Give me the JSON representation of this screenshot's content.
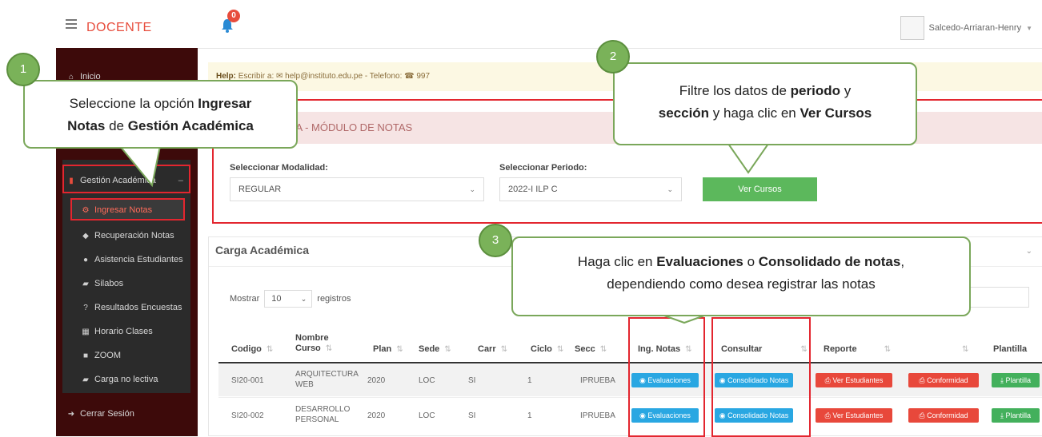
{
  "header": {
    "brand": "DOCENTE",
    "notif_count": "0",
    "user_name": "Salcedo-Arriaran-Henry"
  },
  "sidebar": {
    "items": [
      {
        "label": "Inicio",
        "icon": "home-icon"
      },
      {
        "label": "Gestión Académica",
        "icon": "bookmark-icon"
      },
      {
        "label": "Ingresar Notas",
        "icon": "cogs-icon"
      },
      {
        "label": "Recuperación Notas",
        "icon": "tag-icon"
      },
      {
        "label": "Asistencia Estudiantes",
        "icon": "user-icon"
      },
      {
        "label": "Silabos",
        "icon": "book-icon"
      },
      {
        "label": "Resultados Encuestas",
        "icon": "question-icon"
      },
      {
        "label": "Horario Clases",
        "icon": "table-icon"
      },
      {
        "label": "ZOOM",
        "icon": "video-icon"
      },
      {
        "label": "Carga no lectiva",
        "icon": "book-icon"
      },
      {
        "label": "Cerrar Sesión",
        "icon": "sign-out-icon"
      }
    ],
    "collapse_symbol": "–"
  },
  "help": {
    "prefix": "Help:",
    "text": " Escribir a: ✉ help@instituto.edu.pe - Telefono: ☎ 997"
  },
  "module": {
    "title": "ÉMICA - MÓDULO DE NOTAS",
    "modalidad_label": "Seleccionar Modalidad:",
    "modalidad_value": "REGULAR",
    "periodo_label": "Seleccionar Periodo:",
    "periodo_value": "2022-I ILP C",
    "ver_cursos": "Ver Cursos"
  },
  "carga": {
    "title": "Carga Académica",
    "mostrar": "Mostrar",
    "mostrar_value": "10",
    "registros": "registros",
    "columns": [
      "Codigo",
      "Nombre Curso",
      "Plan",
      "Sede",
      "Carr",
      "Ciclo",
      "Secc",
      "Ing. Notas",
      "Consultar",
      "Reporte",
      "",
      "Plantilla"
    ],
    "rows": [
      {
        "codigo": "SI20-001",
        "curso": "ARQUITECTURA WEB",
        "plan": "2020",
        "sede": "LOC",
        "carr": "SI",
        "ciclo": "1",
        "secc": "IPRUEBA"
      },
      {
        "codigo": "SI20-002",
        "curso": "DESARROLLO PERSONAL",
        "plan": "2020",
        "sede": "LOC",
        "carr": "SI",
        "ciclo": "1",
        "secc": "IPRUEBA"
      }
    ],
    "btn_evaluaciones": "◉ Evaluaciones",
    "btn_consolidado": "◉ Consolidado Notas",
    "btn_ver_estudiantes": "⎙ Ver Estudiantes",
    "btn_conformidad": "⎙ Conformidad",
    "btn_plantilla": "⤓ Plantilla"
  },
  "callouts": {
    "c1": {
      "num": "1",
      "a": "Seleccione la opción ",
      "b": "Ingresar",
      "c": "Notas",
      "d": " de ",
      "e": "Gestión Académica"
    },
    "c2": {
      "num": "2",
      "a": "Filtre los datos de ",
      "b": "periodo",
      "c": " y",
      "d": "sección",
      "e": " y haga clic en ",
      "f": "Ver Cursos"
    },
    "c3": {
      "num": "3",
      "a": "Haga clic en ",
      "b": "Evaluaciones",
      "c": " o ",
      "d": "Consolidado de notas",
      "e": ",",
      "f": "dependiendo como desea registrar las notas"
    }
  },
  "colors": {
    "brand": "#e74c3c",
    "highlight": "#e3262f",
    "callout_border": "#7aa75a",
    "info": "#29a7e2",
    "danger": "#e8483b",
    "success": "#43b05c"
  }
}
